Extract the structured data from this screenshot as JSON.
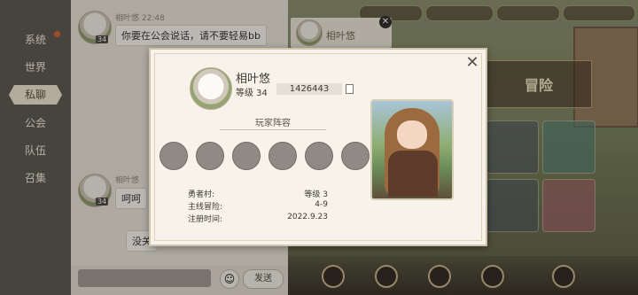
{
  "sidebar": {
    "items": [
      {
        "label": "系统",
        "active": false
      },
      {
        "label": "世界",
        "active": false
      },
      {
        "label": "私聊",
        "active": true
      },
      {
        "label": "公会",
        "active": false
      },
      {
        "label": "队伍",
        "active": false
      },
      {
        "label": "召集",
        "active": false
      }
    ]
  },
  "chat": {
    "messages": [
      {
        "sender": "相叶悠",
        "time": "22:48",
        "level": "34",
        "text": "你要在公会说话，请不要轻易bb"
      },
      {
        "sender": "相叶悠",
        "time": "",
        "level": "34",
        "text": "呵呵"
      },
      {
        "sender": "",
        "time": "",
        "level": "",
        "text": "没关"
      }
    ],
    "send_label": "发送"
  },
  "ghost": {
    "name": "相叶悠"
  },
  "game": {
    "banner": "冒险"
  },
  "profile": {
    "name": "相叶悠",
    "level_label": "等级 34",
    "player_id": "1426443",
    "lineup_title": "玩家阵容",
    "slots": 6,
    "info": [
      {
        "label": "勇者村:",
        "value": "等级 3"
      },
      {
        "label": "主线冒险:",
        "value": "4-9"
      },
      {
        "label": "注册时间:",
        "value": "2022.9.23"
      }
    ],
    "close_symbol": "✕"
  },
  "colors": {
    "accent": "#d9632e",
    "panel": "#f7f3ea",
    "sidebar": "#5b574f"
  }
}
